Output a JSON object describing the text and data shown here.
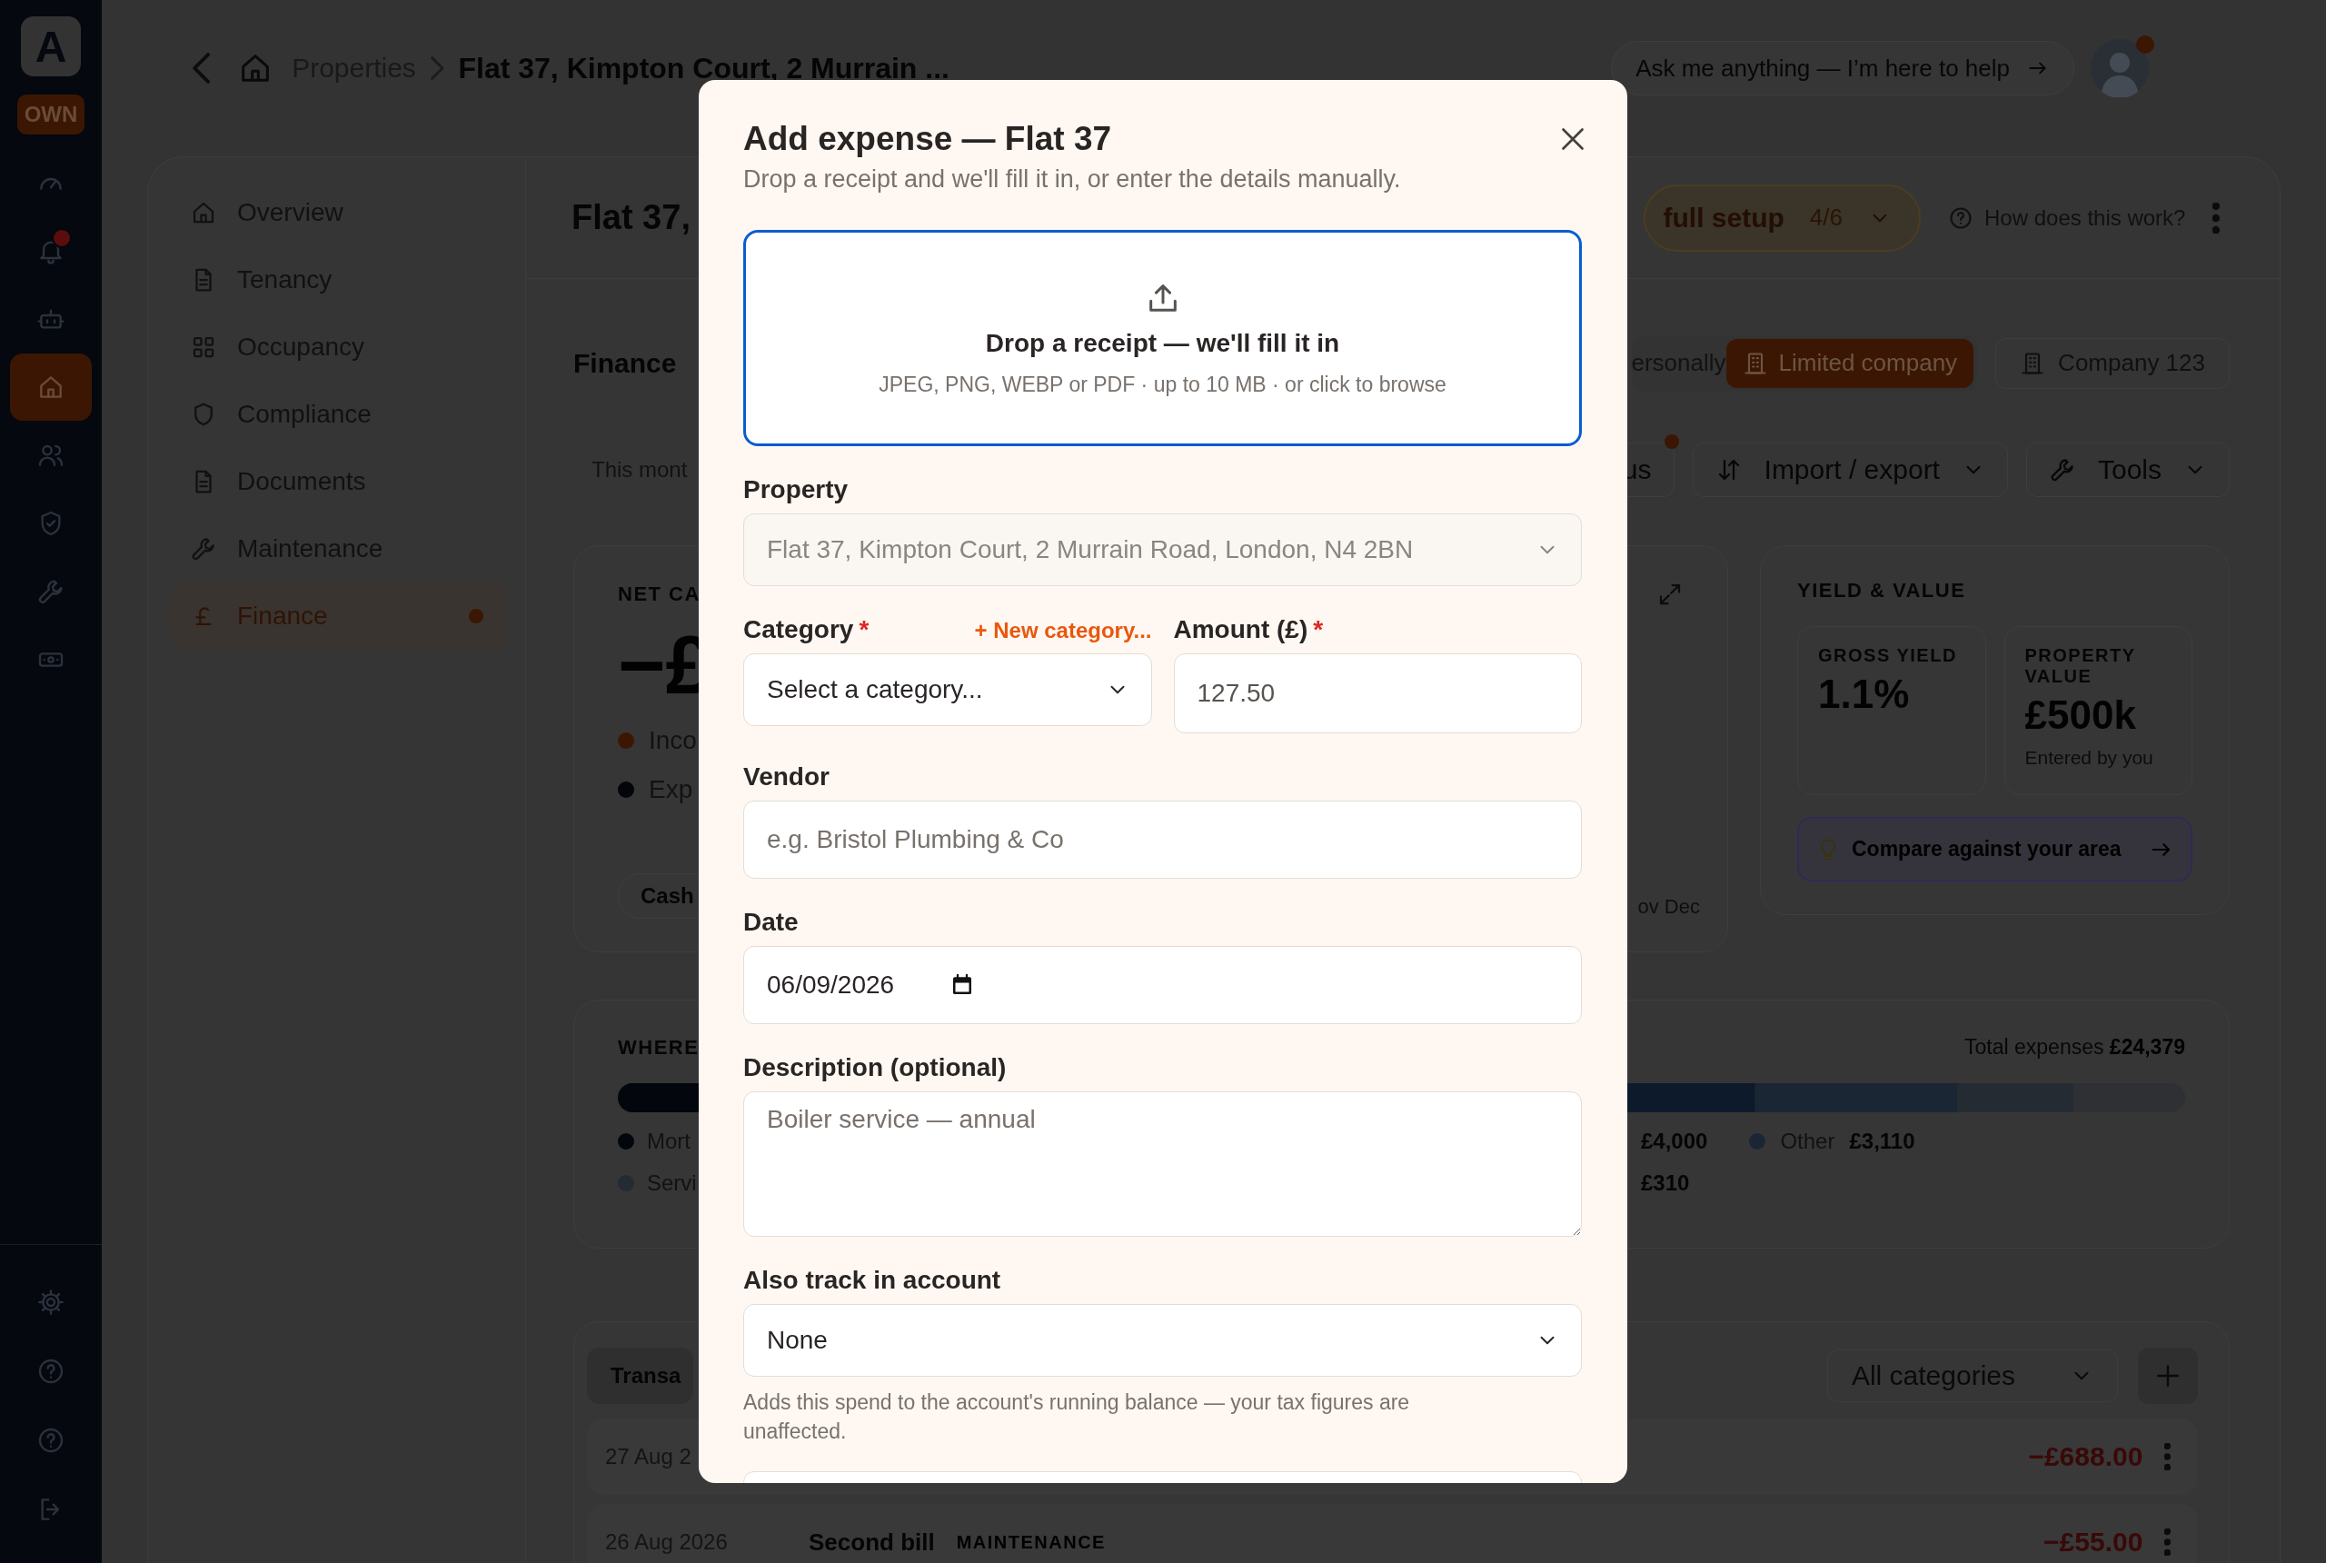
{
  "rail": {
    "logo": "A",
    "badge": "OWN",
    "items": [
      {
        "kind": "gauge",
        "selected": false,
        "alert": false
      },
      {
        "kind": "bell",
        "selected": false,
        "alert": true
      },
      {
        "kind": "robot",
        "selected": false,
        "alert": false
      },
      {
        "kind": "home",
        "selected": true,
        "alert": false
      },
      {
        "kind": "people",
        "selected": false,
        "alert": false
      },
      {
        "kind": "shield-check",
        "selected": false,
        "alert": false
      },
      {
        "kind": "wrench",
        "selected": false,
        "alert": false
      },
      {
        "kind": "cash",
        "selected": false,
        "alert": false
      }
    ],
    "footer": [
      {
        "kind": "gear"
      },
      {
        "kind": "help"
      },
      {
        "kind": "help"
      },
      {
        "kind": "logout"
      }
    ]
  },
  "breadcrumb": [
    {
      "label": "Properties",
      "current": false
    },
    {
      "label": "Flat 37, Kimpton Court, 2 Murrain ...",
      "current": true
    }
  ],
  "assistant": "Ask me anything — I’m here to help",
  "avatar": {
    "alert": true
  },
  "nav": [
    {
      "label": "Overview",
      "kind": "home",
      "selected": false,
      "alert": false
    },
    {
      "label": "Tenancy",
      "kind": "doc",
      "selected": false,
      "alert": false
    },
    {
      "label": "Occupancy",
      "kind": "grid",
      "selected": false,
      "alert": false
    },
    {
      "label": "Compliance",
      "kind": "shield",
      "selected": false,
      "alert": false
    },
    {
      "label": "Documents",
      "kind": "doc",
      "selected": false,
      "alert": false
    },
    {
      "label": "Maintenance",
      "kind": "wrench",
      "selected": false,
      "alert": false
    },
    {
      "label": "Finance",
      "kind": "pound",
      "selected": true,
      "alert": true
    }
  ],
  "page_title": "Flat 37,",
  "setup": {
    "label": "full setup",
    "progress": "4/6"
  },
  "help_link": "How does this work?",
  "section_title": "Finance",
  "ownership": [
    {
      "label": "ersonally",
      "selected": false
    },
    {
      "label": "Limited company",
      "selected": true
    }
  ],
  "companies": [
    "Company 123"
  ],
  "period": "This mont",
  "toolbar": [
    {
      "label": "us",
      "kind": "plain",
      "alert": true
    },
    {
      "label": "Import / export",
      "kind": "sort",
      "alert": false
    },
    {
      "label": "Tools",
      "kind": "wrench",
      "alert": false
    }
  ],
  "cashflow": {
    "title": "NET CA",
    "amount": "−£",
    "legend": [
      {
        "label": "Inco",
        "color": "#3b1703"
      },
      {
        "label": "Exp",
        "color": "#03050a"
      }
    ],
    "view": "Cash",
    "axis": "ov Dec"
  },
  "yield": {
    "title": "YIELD & VALUE",
    "stats": [
      {
        "label": "GROSS YIELD",
        "value": "1.1%"
      },
      {
        "label": "PROPERTY VALUE",
        "value": "£500k",
        "note": "Entered by you"
      }
    ],
    "compare": "Compare against your area"
  },
  "breakdown": {
    "title": "WHERE",
    "total_label": "Total expenses",
    "total": "£24,379",
    "legend": [
      {
        "left": {
          "label": "Mort",
          "color": "#03060c"
        },
        "right": [
          {
            "value": "£4,000"
          },
          {
            "label": "Other",
            "value": "£3,110",
            "color": "#1b2635"
          }
        ]
      },
      {
        "left": {
          "label": "Servi",
          "color": "#252b33"
        },
        "right": [
          {
            "value": "£310"
          }
        ]
      }
    ]
  },
  "transactions": {
    "tab": "Transa",
    "filter": "All categories",
    "rows": [
      {
        "date": "27 Aug 2",
        "amount": "−£688.00"
      },
      {
        "date": "26 Aug 2026",
        "title": "Second bill",
        "tag": "MAINTENANCE",
        "amount": "−£55.00"
      }
    ]
  },
  "modal": {
    "title": "Add expense — Flat 37",
    "subtitle": "Drop a receipt and we'll fill it in, or enter the details manually.",
    "dropzone": {
      "title": "Drop a receipt — we'll fill it in",
      "hint": "JPEG, PNG, WEBP or PDF · up to 10 MB · or click to browse"
    },
    "property": {
      "label": "Property",
      "value": "Flat 37, Kimpton Court, 2 Murrain Road, London, N4 2BN",
      "disabled": true
    },
    "category": {
      "label": "Category",
      "required_mark": "*",
      "link": "+ New category...",
      "value": "Select a category..."
    },
    "amount": {
      "label": "Amount (£)",
      "required_mark": "*",
      "value": "127.50"
    },
    "vendor": {
      "label": "Vendor",
      "placeholder": "e.g. Bristol Plumbing & Co"
    },
    "date": {
      "label": "Date",
      "value": "06/09/2026"
    },
    "description": {
      "label": "Description (optional)",
      "placeholder": "Boiler service — annual"
    },
    "account": {
      "label": "Also track in account",
      "value": "None",
      "help": "Adds this spend to the account's running balance — your tax figures are unaffected."
    }
  }
}
